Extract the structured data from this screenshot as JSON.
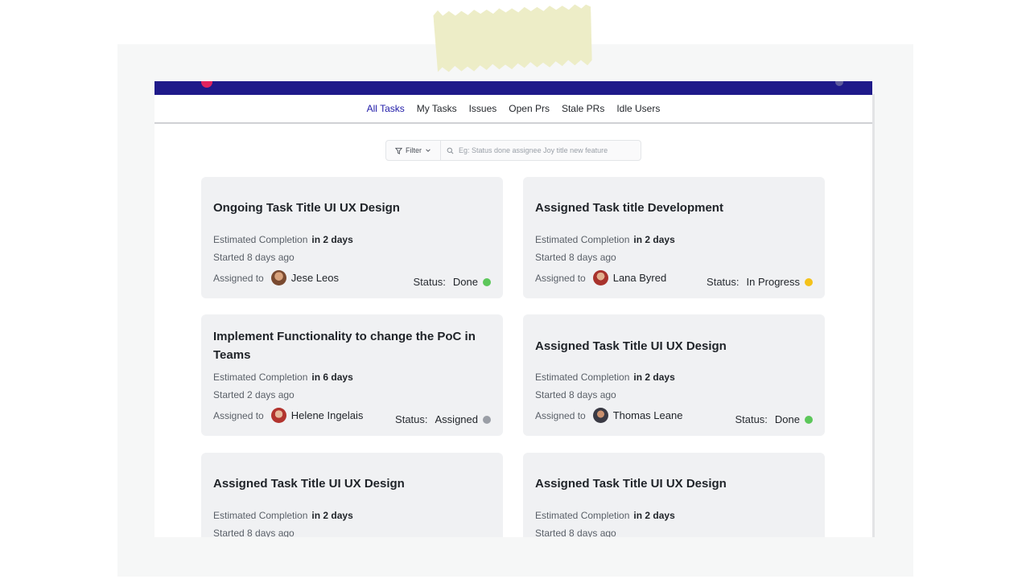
{
  "nav": {
    "tabs": [
      {
        "label": "All Tasks",
        "active": true
      },
      {
        "label": "My Tasks",
        "active": false
      },
      {
        "label": "Issues",
        "active": false
      },
      {
        "label": "Open Prs",
        "active": false
      },
      {
        "label": "Stale PRs",
        "active": false
      },
      {
        "label": "Idle Users",
        "active": false
      }
    ]
  },
  "filter": {
    "button_label": "Filter",
    "search_placeholder": "Eg: Status done assignee Joy title new feature"
  },
  "labels": {
    "estimated": "Estimated Completion",
    "assigned_to": "Assigned to",
    "status": "Status:"
  },
  "colors": {
    "brand": "#1f1a8a",
    "active_tab": "#1f1aa8",
    "status_done": "#5cc75a",
    "status_in_progress": "#f4c21a",
    "status_assigned": "#9a9ea6"
  },
  "cards": [
    {
      "title": "Ongoing Task Title UI UX Design",
      "eta": "in 2 days",
      "started": "Started 8 days ago",
      "assignee": "Jese Leos",
      "status": "Done"
    },
    {
      "title": "Assigned Task title Development",
      "eta": "in 2 days",
      "started": "Started 8 days ago",
      "assignee": "Lana Byred",
      "status": "In Progress"
    },
    {
      "title": "Implement Functionality to change  the PoC in Teams",
      "eta": "in 6 days",
      "started": "Started 2 days ago",
      "assignee": "Helene Ingelais",
      "status": "Assigned"
    },
    {
      "title": "Assigned Task Title UI UX Design",
      "eta": "in 2 days",
      "started": "Started 8 days ago",
      "assignee": "Thomas Leane",
      "status": "Done"
    },
    {
      "title": "Assigned Task Title UI UX Design",
      "eta": "in 2 days",
      "started": "Started 8 days ago"
    },
    {
      "title": "Assigned Task Title UI UX Design",
      "eta": "in 2 days",
      "started": "Started 8 days ago"
    }
  ]
}
